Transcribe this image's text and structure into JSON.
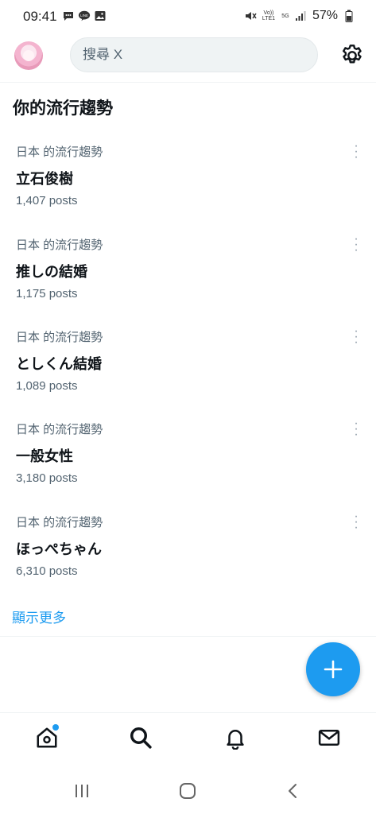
{
  "status_bar": {
    "time": "09:41",
    "battery": "57%",
    "volte_label": "Vo)) LTE1",
    "network_label": "5G"
  },
  "header": {
    "search_placeholder": "搜尋 X"
  },
  "section": {
    "title": "你的流行趨勢"
  },
  "trends": [
    {
      "context": "日本 的流行趨勢",
      "name": "立石俊樹",
      "count": "1,407 posts"
    },
    {
      "context": "日本 的流行趨勢",
      "name": "推しの結婚",
      "count": "1,175 posts"
    },
    {
      "context": "日本 的流行趨勢",
      "name": "としくん結婚",
      "count": "1,089 posts"
    },
    {
      "context": "日本 的流行趨勢",
      "name": "一般女性",
      "count": "3,180 posts"
    },
    {
      "context": "日本 的流行趨勢",
      "name": "ほっぺちゃん",
      "count": "6,310 posts"
    }
  ],
  "show_more": "顯示更多",
  "colors": {
    "accent": "#1d9bf0",
    "text_primary": "#0f1419",
    "text_secondary": "#536471",
    "search_bg": "#eff3f4"
  },
  "bottom_nav": [
    "home-icon",
    "search-icon",
    "bell-icon",
    "mail-icon"
  ],
  "system_nav": [
    "recents-icon",
    "home-circle-icon",
    "back-icon"
  ]
}
